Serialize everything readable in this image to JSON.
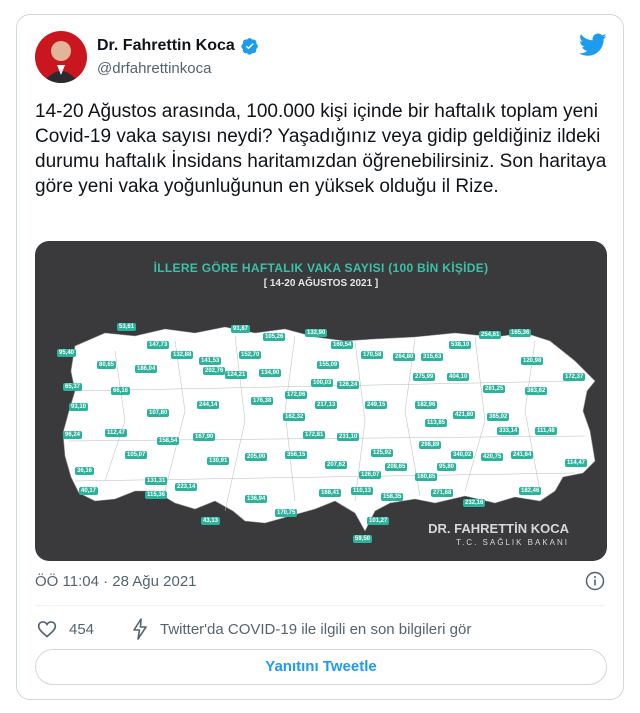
{
  "author": {
    "name": "Dr. Fahrettin Koca",
    "handle": "@drfahrettinkoca",
    "avatar_icon": "profile-photo",
    "verified_icon": "verified-badge-icon"
  },
  "tweet": {
    "text": "14-20 Ağustos arasında, 100.000 kişi içinde bir haftalık toplam yeni Covid-19 vaka sayısı neydi? Yaşadığınız veya gidip geldiğiniz ildeki durumu haftalık İnsidans haritamızdan öğrenebilirsiniz. Son haritaya göre yeni vaka yoğunluğunun en yüksek olduğu il Rize."
  },
  "media": {
    "title": "İLLERE GÖRE HAFTALIK VAKA SAYISI (100 BİN KİŞİDE)",
    "subtitle": "[ 14-20 AĞUSTOS 2021 ]",
    "brand_name": "DR. FAHRETTİN KOCA",
    "brand_subtitle": "T.C. SAĞLIK BAKANI",
    "map_color": "#ffffff",
    "label_color": "#2bb39c",
    "labels": [
      "53,61",
      "95,40",
      "80,65",
      "65,37",
      "147,73",
      "132,88",
      "141,53",
      "91,87",
      "105,26",
      "132,90",
      "160,54",
      "170,58",
      "264,80",
      "315,63",
      "538,10",
      "254,61",
      "165,36",
      "120,98",
      "275,99",
      "383,62",
      "172,37",
      "281,25",
      "186,04",
      "202,76",
      "152,70",
      "124,21",
      "134,90",
      "155,09",
      "126,24",
      "249,15",
      "404,10",
      "182,96",
      "421,80",
      "385,02",
      "66,16",
      "93,10",
      "107,80",
      "244,14",
      "176,38",
      "172,06",
      "100,03",
      "217,13",
      "162,32",
      "113,85",
      "333,14",
      "111,48",
      "112,47",
      "105,07",
      "96,24",
      "158,54",
      "167,90",
      "172,81",
      "231,10",
      "298,89",
      "125,92",
      "208,65",
      "340,02",
      "420,75",
      "241,64",
      "114,47",
      "36,16",
      "131,31",
      "130,91",
      "205,00",
      "356,15",
      "207,62",
      "126,07",
      "160,85",
      "40,17",
      "115,36",
      "223,14",
      "95,80",
      "271,68",
      "232,16",
      "182,46",
      "136,94",
      "168,41",
      "110,13",
      "158,35",
      "43,13",
      "170,75",
      "101,27",
      "59,50"
    ]
  },
  "footer": {
    "time": "ÖÖ 11:04 · 28 Ağu 2021",
    "likes": "454",
    "covid_link": "Twitter'da COVID-19 ile ilgili en son bilgileri gör",
    "reply_label": "Yanıtını Tweetle"
  },
  "colors": {
    "accent": "#1d9bf0",
    "text": "#0f1419",
    "secondary": "#536471"
  }
}
